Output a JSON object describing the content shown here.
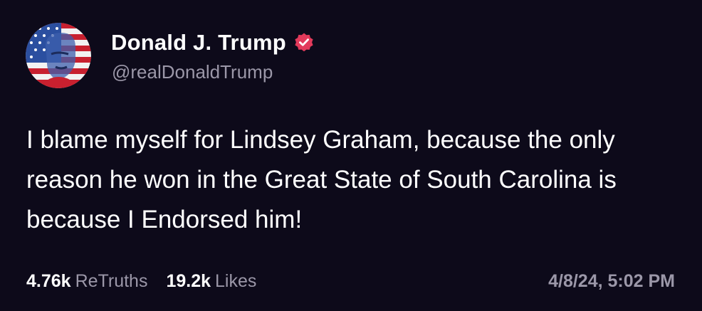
{
  "author": {
    "display_name": "Donald J. Trump",
    "handle": "@realDonaldTrump",
    "verified_icon": "verified-badge-icon",
    "verified_color": "#e23a5b"
  },
  "post": {
    "text": "I blame myself for Lindsey Graham, because the only reason he won in the Great State of South Carolina is because I Endorsed him!"
  },
  "stats": {
    "retruths_count": "4.76k",
    "retruths_label": "ReTruths",
    "likes_count": "19.2k",
    "likes_label": "Likes"
  },
  "timestamp": "4/8/24, 5:02 PM",
  "colors": {
    "background": "#0d0a1a",
    "primary_text": "#ffffff",
    "secondary_text": "#9b97a8"
  }
}
